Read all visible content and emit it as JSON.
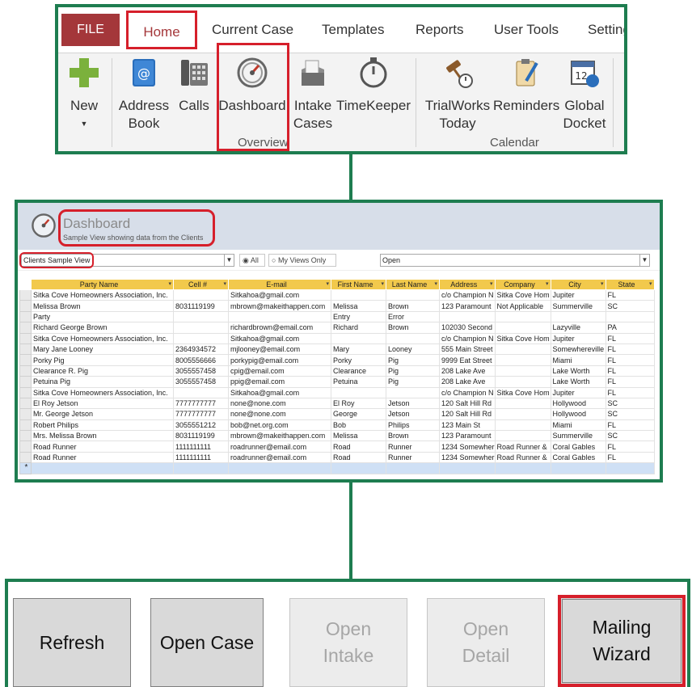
{
  "ribbon": {
    "tabs": [
      "FILE",
      "Home",
      "Current Case",
      "Templates",
      "Reports",
      "User Tools",
      "Setting"
    ],
    "buttons": {
      "new": "New",
      "address_book": [
        "Address",
        "Book"
      ],
      "calls": "Calls",
      "dashboard": "Dashboard",
      "intake_cases": [
        "Intake",
        "Cases"
      ],
      "timekeeper": "TimeKeeper",
      "trialworks_today": [
        "TrialWorks",
        "Today"
      ],
      "reminders": "Reminders",
      "global_docket": [
        "Global",
        "Docket"
      ]
    },
    "groups": {
      "overview": "Overview",
      "calendar": "Calendar"
    },
    "colors": {
      "file_tab": "#a4373a",
      "highlight": "#d61f2b",
      "new_plus": "#7bb13c",
      "address_book": "#2a6ebb"
    }
  },
  "dashboard": {
    "title": "Dashboard",
    "subtitle": "Sample View showing data from the Clients",
    "view_select": "Clients Sample View",
    "radio_all": "All",
    "radio_my_views": "My Views Only",
    "status_select": "Open",
    "columns": [
      "Party Name",
      "Cell #",
      "E-mail",
      "First Name",
      "Last Name",
      "Address",
      "Company",
      "City",
      "State"
    ],
    "rows": [
      [
        "Sitka Cove Homeowners Association, Inc.",
        "",
        "Sitkahoa@gmail.com",
        "",
        "",
        "c/o Champion N",
        "Sitka Cove Hom",
        "Jupiter",
        "FL"
      ],
      [
        "Melissa Brown",
        "8031119199",
        "mbrown@makeithappen.com",
        "Melissa",
        "Brown",
        "123 Paramount",
        "Not Applicable",
        "Summerville",
        "SC"
      ],
      [
        "Party",
        "",
        "",
        "Entry",
        "Error",
        "",
        "",
        "",
        ""
      ],
      [
        "Richard George Brown",
        "",
        "richardbrown@email.com",
        "Richard",
        "Brown",
        "102030 Second",
        "",
        "Lazyville",
        "PA"
      ],
      [
        "Sitka Cove Homeowners Association, Inc.",
        "",
        "Sitkahoa@gmail.com",
        "",
        "",
        "c/o Champion N",
        "Sitka Cove Hom",
        "Jupiter",
        "FL"
      ],
      [
        "Mary  Jane Looney",
        "2364934572",
        "mjlooney@email.com",
        "Mary",
        "Looney",
        "555 Main Street",
        "",
        "Somewhereville",
        "FL"
      ],
      [
        "Porky Pig",
        "8005556666",
        "porkypig@email.com",
        "Porky",
        "Pig",
        "9999 Eat Street",
        "",
        "Miami",
        "FL"
      ],
      [
        "Clearance R. Pig",
        "3055557458",
        "cpig@email.com",
        "Clearance",
        "Pig",
        "208 Lake Ave",
        "",
        "Lake Worth",
        "FL"
      ],
      [
        "Petuina Pig",
        "3055557458",
        "ppig@email.com",
        "Petuina",
        "Pig",
        "208 Lake Ave",
        "",
        "Lake Worth",
        "FL"
      ],
      [
        "Sitka Cove Homeowners Association, Inc.",
        "",
        "Sitkahoa@gmail.com",
        "",
        "",
        "c/o Champion N",
        "Sitka Cove Hom",
        "Jupiter",
        "FL"
      ],
      [
        "El Roy Jetson",
        "7777777777",
        "none@none.com",
        "El Roy",
        "Jetson",
        "120 Salt Hill Rd",
        "",
        "Hollywood",
        "SC"
      ],
      [
        "Mr. George Jetson",
        "7777777777",
        "none@none.com",
        "George",
        "Jetson",
        "120 Salt Hill Rd",
        "",
        "Hollywood",
        "SC"
      ],
      [
        "Robert Philips",
        "3055551212",
        "bob@net.org.com",
        "Bob",
        "Philips",
        "123 Main St",
        "",
        "Miami",
        "FL"
      ],
      [
        "Mrs. Melissa Brown",
        "8031119199",
        "mbrown@makeithappen.com",
        "Melissa",
        "Brown",
        "123 Paramount",
        "",
        "Summerville",
        "SC"
      ],
      [
        "Road Runner",
        "1111111111",
        "roadrunner@email.com",
        "Road",
        "Runner",
        "1234 Somewher",
        "Road Runner &",
        "Coral Gables",
        "FL"
      ],
      [
        "Road Runner",
        "1111111111",
        "roadrunner@email.com",
        "Road",
        "Runner",
        "1234 Somewher",
        "Road Runner &",
        "Coral Gables",
        "FL"
      ]
    ],
    "new_row_marker": "*",
    "colors": {
      "header_band": "#d7dee9",
      "column_header": "#f2c94c",
      "new_row": "#cfe0f5"
    }
  },
  "actions": {
    "refresh": "Refresh",
    "open_case": "Open Case",
    "open_intake": [
      "Open",
      "Intake"
    ],
    "open_detail": [
      "Open",
      "Detail"
    ],
    "mailing_wizard": [
      "Mailing",
      "Wizard"
    ]
  },
  "frame_color": "#1e7d50"
}
